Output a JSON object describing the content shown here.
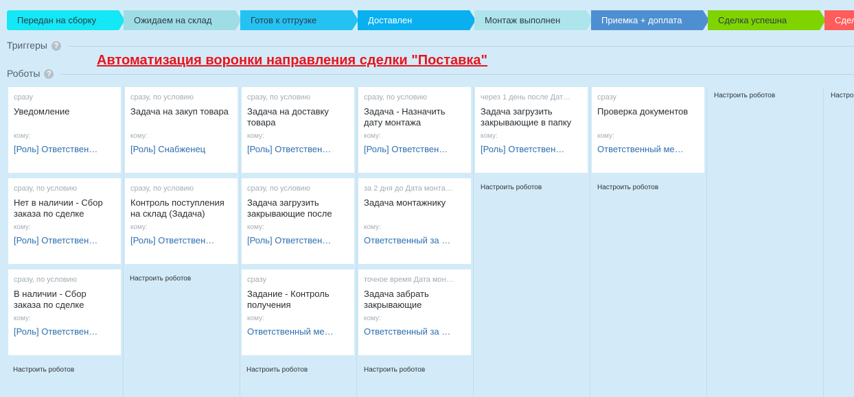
{
  "stages": [
    {
      "label": "Передан на сборку",
      "color": "#14e7f5"
    },
    {
      "label": "Ожидаем на склад",
      "color": "#9fdde6"
    },
    {
      "label": "Готов к отгрузке",
      "color": "#24c2f3"
    },
    {
      "label": "Доставлен",
      "color": "#08b0f0"
    },
    {
      "label": "Монтаж выполнен",
      "color": "#aee4ec"
    },
    {
      "label": "Приемка + доплата",
      "color": "#4d8fd1"
    },
    {
      "label": "Сделка успешна",
      "color": "#7fd400"
    },
    {
      "label": "Сдел",
      "color": "#ff5c5c"
    }
  ],
  "triggers": {
    "label": "Триггеры"
  },
  "robots": {
    "label": "Роботы"
  },
  "headline": "Автоматизация воронки направления сделки \"Поставка\"",
  "to_label": "кому:",
  "setup_label": "Настроить роботов",
  "setup_partial": "Настро",
  "columns": [
    {
      "cards": [
        {
          "when": "сразу",
          "title": "Уведомление",
          "resp": "[Роль] Ответствен…"
        },
        {
          "when": "сразу, по условию",
          "title": "Нет в наличии - Сбор заказа по сделке",
          "resp": "[Роль] Ответствен…"
        },
        {
          "when": "сразу, по условию",
          "title": "В наличии - Сбор заказа по сделке",
          "resp": "[Роль] Ответствен…"
        }
      ]
    },
    {
      "cards": [
        {
          "when": "сразу, по условию",
          "title": "Задача на закуп товара",
          "resp": "[Роль] Снабженец"
        },
        {
          "when": "сразу, по условию",
          "title": "Контроль поступления на склад (Задача)",
          "resp": "[Роль] Ответствен…"
        }
      ]
    },
    {
      "cards": [
        {
          "when": "сразу, по условию",
          "title": "Задача на доставку товара",
          "resp": "[Роль] Ответствен…"
        },
        {
          "when": "сразу, по условию",
          "title": "Задача загрузить закрывающие после",
          "resp": "[Роль] Ответствен…"
        },
        {
          "when": "сразу",
          "title": "Задание - Контроль получения",
          "resp": "Ответственный ме…"
        }
      ]
    },
    {
      "cards": [
        {
          "when": "сразу, по условию",
          "title": "Задача - Назначить дату монтажа",
          "resp": "[Роль] Ответствен…"
        },
        {
          "when": "за 2 дня до Дата монта…",
          "title": "Задача монтажнику",
          "resp": "Ответственный за …"
        },
        {
          "when": "точное время Дата мон…",
          "title": "Задача забрать закрывающие",
          "resp": "Ответственный за …"
        }
      ]
    },
    {
      "cards": [
        {
          "when": "через 1 день после Дат…",
          "title": "Задача загрузить закрывающие в папку",
          "resp": "[Роль] Ответствен…"
        }
      ]
    },
    {
      "cards": [
        {
          "when": "сразу",
          "title": "Проверка документов",
          "resp": "Ответственный ме…"
        }
      ]
    },
    {
      "cards": []
    }
  ]
}
